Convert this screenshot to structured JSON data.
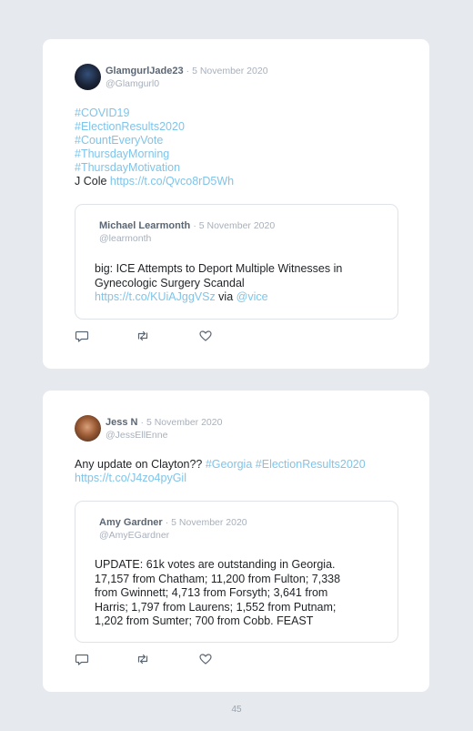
{
  "tweets": [
    {
      "author_name": "GlamgurlJade23",
      "date": "· 5 November 2020",
      "handle": "@Glamgurl0",
      "text_lines": [
        [
          {
            "t": "#COVID19",
            "link": true
          }
        ],
        [
          {
            "t": "#ElectionResults2020",
            "link": true
          }
        ],
        [
          {
            "t": "#CountEveryVote",
            "link": true
          }
        ],
        [
          {
            "t": "#ThursdayMorning",
            "link": true
          }
        ],
        [
          {
            "t": "#ThursdayMotivation",
            "link": true
          }
        ],
        [
          {
            "t": "J Cole ",
            "link": false
          },
          {
            "t": "https://t.co/Qvco8rD5Wh",
            "link": true
          }
        ]
      ],
      "quote": {
        "author_name": "Michael Learmonth",
        "date": "· 5 November 2020",
        "handle": "@learmonth",
        "text_lines": [
          [
            {
              "t": "big: ICE Attempts to Deport Multiple Witnesses in",
              "link": false
            }
          ],
          [
            {
              "t": "Gynecologic Surgery Scandal",
              "link": false
            }
          ],
          [
            {
              "t": "https://t.co/KUiAJggVSz",
              "link": true
            },
            {
              "t": " via ",
              "link": false
            },
            {
              "t": "@vice",
              "link": true
            }
          ]
        ]
      },
      "actions": [
        "reply-icon",
        "retweet-icon",
        "like-icon"
      ]
    },
    {
      "author_name": "Jess N",
      "date": "· 5 November 2020",
      "handle": "@JessEllEnne",
      "text_lines": [
        [
          {
            "t": "Any update on Clayton?? ",
            "link": false
          },
          {
            "t": "#Georgia",
            "link": true
          },
          {
            "t": " ",
            "link": false
          },
          {
            "t": "#ElectionResults2020",
            "link": true
          }
        ],
        [
          {
            "t": "https://t.co/J4zo4pyGil",
            "link": true
          }
        ]
      ],
      "quote": {
        "author_name": "Amy Gardner",
        "date": "· 5 November 2020",
        "handle": "@AmyEGardner",
        "text_lines": [
          [
            {
              "t": "UPDATE: 61k votes are outstanding in Georgia.",
              "link": false
            }
          ],
          [
            {
              "t": "17,157 from Chatham; 11,200 from Fulton; 7,338",
              "link": false
            }
          ],
          [
            {
              "t": "from Gwinnett; 4,713 from Forsyth; 3,641 from",
              "link": false
            }
          ],
          [
            {
              "t": "Harris; 1,797 from Laurens; 1,552 from Putnam;",
              "link": false
            }
          ],
          [
            {
              "t": "1,202 from Sumter; 700 from Cobb. FEAST",
              "link": false
            }
          ]
        ]
      },
      "actions": [
        "reply-icon",
        "retweet-icon",
        "like-icon"
      ]
    }
  ],
  "page_number": "45",
  "colors": {
    "background": "#e6e9ee",
    "card": "#ffffff",
    "link": "#7fc4ea",
    "muted": "#a8b0bb",
    "name": "#5b6673",
    "text": "#1f2326"
  }
}
